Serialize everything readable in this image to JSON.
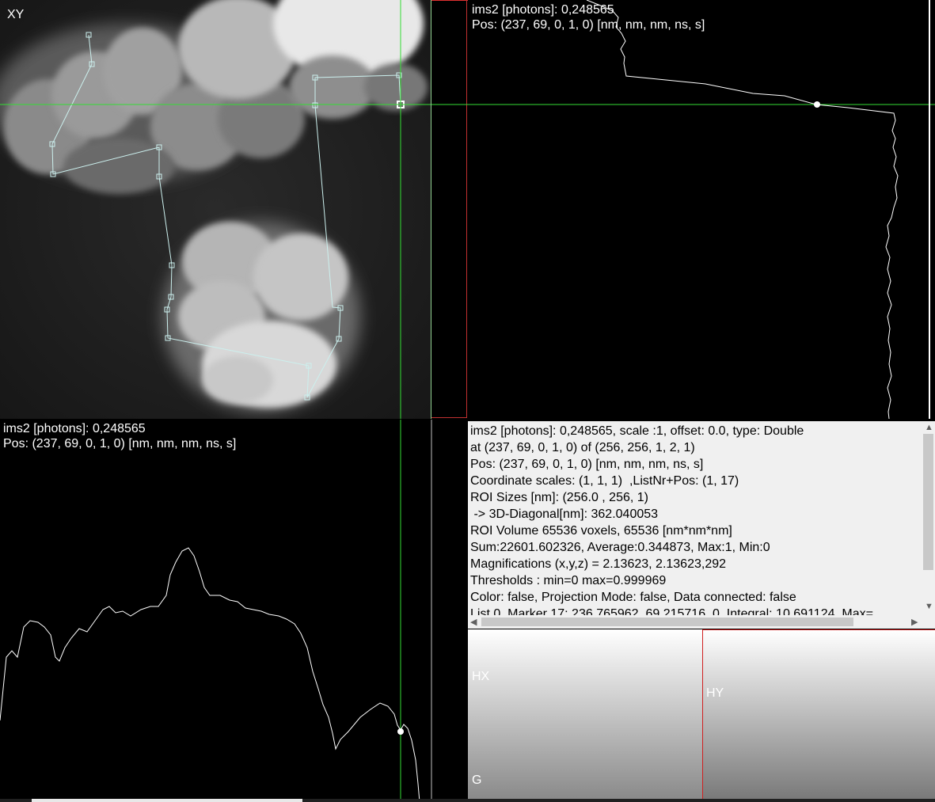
{
  "xy_view": {
    "label": "XY"
  },
  "yz_view": {
    "value_line": "ims2 [photons]: 0,248565",
    "pos_line": "Pos: (237, 69, 0, 1, 0) [nm, nm, nm, ns, s]"
  },
  "xz_view": {
    "value_line": "ims2 [photons]: 0,248565",
    "pos_line": "Pos: (237, 69, 0, 1, 0) [nm, nm, nm, ns, s]"
  },
  "info": {
    "lines": [
      "ims2 [photons]: 0,248565, scale :1, offset: 0.0, type: Double",
      "at (237, 69, 0, 1, 0) of (256, 256, 1, 2, 1)",
      "Pos: (237, 69, 0, 1, 0) [nm, nm, nm, ns, s]",
      "Coordinate scales: (1, 1, 1)  ,ListNr+Pos: (1, 17)",
      "ROI Sizes [nm]: (256.0 , 256, 1)",
      " -> 3D-Diagonal[nm]: 362.040053",
      "ROI Volume 65536 voxels, 65536 [nm*nm*nm]",
      "Sum:22601.602326, Average:0.344873, Max:1, Min:0",
      "Magnifications (x,y,z) = 2.13623, 2.13623,292",
      "Thresholds : min=0 max=0.999969",
      "Color: false, Projection Mode: false, Data connected: false",
      "List 0, Marker 17: 236.765962, 69.215716, 0, Integral: 10.691124, Max="
    ]
  },
  "histograms": {
    "hx_label": "HX",
    "hy_label": "HY",
    "g_label": "G"
  },
  "icons": {
    "scroll_up": "▲",
    "scroll_down": "▼",
    "scroll_left": "◀",
    "scroll_right": "▶"
  },
  "colors": {
    "crosshair": "#33dd33",
    "frame": "#e03030",
    "marker_line": "#ccf0ee"
  }
}
